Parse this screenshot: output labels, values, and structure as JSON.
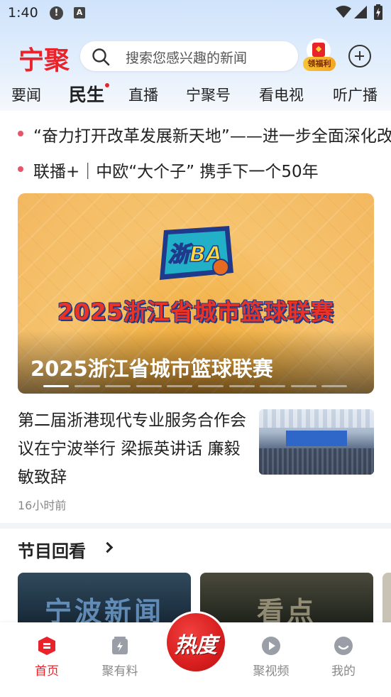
{
  "status_bar": {
    "time": "1:40",
    "alert_glyph": "!",
    "a_glyph": "A"
  },
  "header": {
    "logo": "宁聚",
    "search_placeholder": "搜索您感兴趣的新闻",
    "gift_label": "领福利"
  },
  "tabs": [
    {
      "label": "要闻"
    },
    {
      "label": "民生",
      "active": true
    },
    {
      "label": "直播"
    },
    {
      "label": "宁聚号"
    },
    {
      "label": "看电视"
    },
    {
      "label": "听广播"
    }
  ],
  "headlines": [
    "“奋力打开改革发展新天地”——进一步全面深化改革",
    "联播+｜中欧“大个子” 携手下一个50年"
  ],
  "banner": {
    "emblem_text": "浙BA",
    "big_title": "2025浙江省城市篮球联赛",
    "caption": "2025浙江省城市篮球联赛",
    "slide_count": 10,
    "active_slide": 1
  },
  "article": {
    "title": "第二届浙港现代专业服务合作会议在宁波举行 梁振英讲话 廉毅敏致辞",
    "time": "16小时前"
  },
  "section": {
    "title": "节目回看"
  },
  "replays": [
    {
      "title": "宁波新闻"
    },
    {
      "title": "看点"
    }
  ],
  "bottom_nav": {
    "items": [
      {
        "label": "首页",
        "icon": "home-icon",
        "active": true
      },
      {
        "label": "聚有料",
        "icon": "flash-icon"
      },
      {
        "label": "聚视频",
        "icon": "play-icon"
      },
      {
        "label": "我的",
        "icon": "profile-icon"
      }
    ],
    "center": "热度"
  },
  "colors": {
    "brand_red": "#e8232a",
    "banner_orange": "#f2b34a",
    "muted": "#888888"
  }
}
